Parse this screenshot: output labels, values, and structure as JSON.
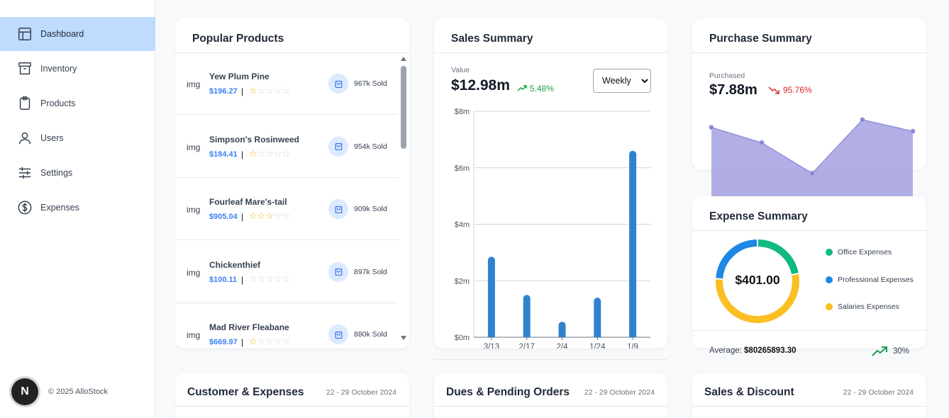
{
  "sidebar": {
    "items": [
      {
        "label": "Dashboard",
        "icon": "layout-icon",
        "active": true
      },
      {
        "label": "Inventory",
        "icon": "archive-icon"
      },
      {
        "label": "Products",
        "icon": "clipboard-icon"
      },
      {
        "label": "Users",
        "icon": "user-icon"
      },
      {
        "label": "Settings",
        "icon": "sliders-icon"
      },
      {
        "label": "Expenses",
        "icon": "dollar-circle-icon"
      }
    ],
    "logo_letter": "N",
    "copyright": "© 2025 AlloStock"
  },
  "popular_products": {
    "title": "Popular Products",
    "img_label": "img",
    "items": [
      {
        "name": "Yew Plum Pine",
        "price": "$196.27",
        "rating": 1,
        "sold": "967k Sold"
      },
      {
        "name": "Simpson's Rosinweed",
        "price": "$184.41",
        "rating": 1,
        "sold": "954k Sold"
      },
      {
        "name": "Fourleaf Mare's-tail",
        "price": "$905.04",
        "rating": 3,
        "sold": "909k Sold"
      },
      {
        "name": "Chickenthief",
        "price": "$100.11",
        "rating": 0,
        "sold": "897k Sold"
      },
      {
        "name": "Mad River Fleabane",
        "price": "$669.97",
        "rating": 1,
        "sold": "880k Sold"
      }
    ]
  },
  "sales_summary": {
    "title": "Sales Summary",
    "value_label": "Value",
    "value": "$12.98m",
    "change": "5.48%",
    "period": "Weekly",
    "period_options": [
      "Weekly"
    ],
    "bar_color": "#3182ce"
  },
  "purchase_summary": {
    "title": "Purchase Summary",
    "label": "Purchased",
    "value": "$7.88m",
    "change": "95.76%",
    "area_color": "#8884d8"
  },
  "expense_summary": {
    "title": "Expense Summary",
    "total": "$401.00",
    "legend": [
      {
        "label": "Office Expenses",
        "color": "#10b981"
      },
      {
        "label": "Professional Expenses",
        "color": "#1e88e5"
      },
      {
        "label": "Salaries Expenses",
        "color": "#fbbf24"
      }
    ],
    "average_label": "Average:",
    "average_value": "$80265893.30",
    "trend": "30%"
  },
  "bottom_cards": [
    {
      "title": "Customer & Expenses",
      "date": "22 - 29 October 2024"
    },
    {
      "title": "Dues & Pending Orders",
      "date": "22 - 29 October 2024"
    },
    {
      "title": "Sales & Discount",
      "date": "22 - 29 October 2024"
    }
  ],
  "chart_data": [
    {
      "type": "bar",
      "categories": [
        "3/13",
        "2/17",
        "2/4",
        "1/24",
        "1/9"
      ],
      "values": [
        2.85,
        1.5,
        0.55,
        1.4,
        6.6
      ],
      "unit": "millions",
      "ylim": [
        0,
        8
      ],
      "yticks": [
        "$0m",
        "$2m",
        "$4m",
        "$6m",
        "$8m"
      ],
      "grid": true
    },
    {
      "type": "area",
      "values": [
        9,
        7,
        3,
        10,
        8.5
      ],
      "ylim": [
        0,
        10
      ],
      "grid": false
    },
    {
      "type": "pie",
      "variant": "donut",
      "categories": [
        "Office Expenses",
        "Professional Expenses",
        "Salaries Expenses"
      ],
      "values": [
        0.22,
        0.24,
        0.54
      ]
    }
  ]
}
